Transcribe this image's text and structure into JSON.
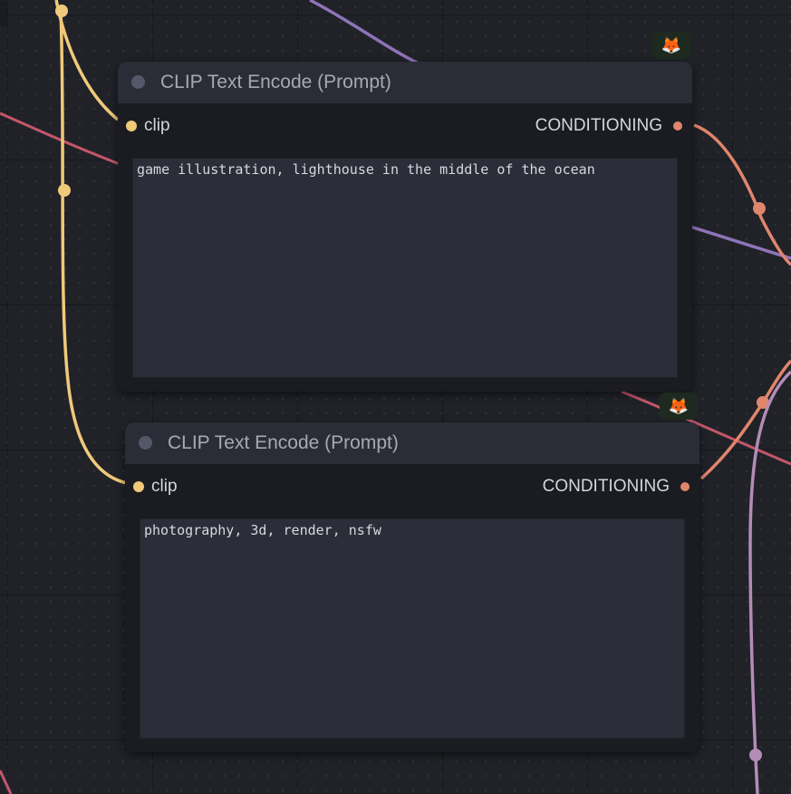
{
  "nodes": [
    {
      "title": "CLIP Text Encode (Prompt)",
      "input_label": "clip",
      "output_label": "CONDITIONING",
      "prompt_text": "game illustration, lighthouse in the middle of the ocean"
    },
    {
      "title": "CLIP Text Encode (Prompt)",
      "input_label": "clip",
      "output_label": "CONDITIONING",
      "prompt_text": "photography, 3d, render, nsfw"
    }
  ],
  "badge_icon": "fox-icon",
  "badge_glyph": "🦊",
  "colors": {
    "canvas_bg": "#202228",
    "node_body": "#1b1c21",
    "node_header": "#2a2d36",
    "clip_wire": "#f0c97a",
    "conditioning_wire": "#e0866c",
    "latent_wire": "#8e74b8",
    "model_wire": "#c4576a",
    "vae_wire": "#b38cb8"
  }
}
